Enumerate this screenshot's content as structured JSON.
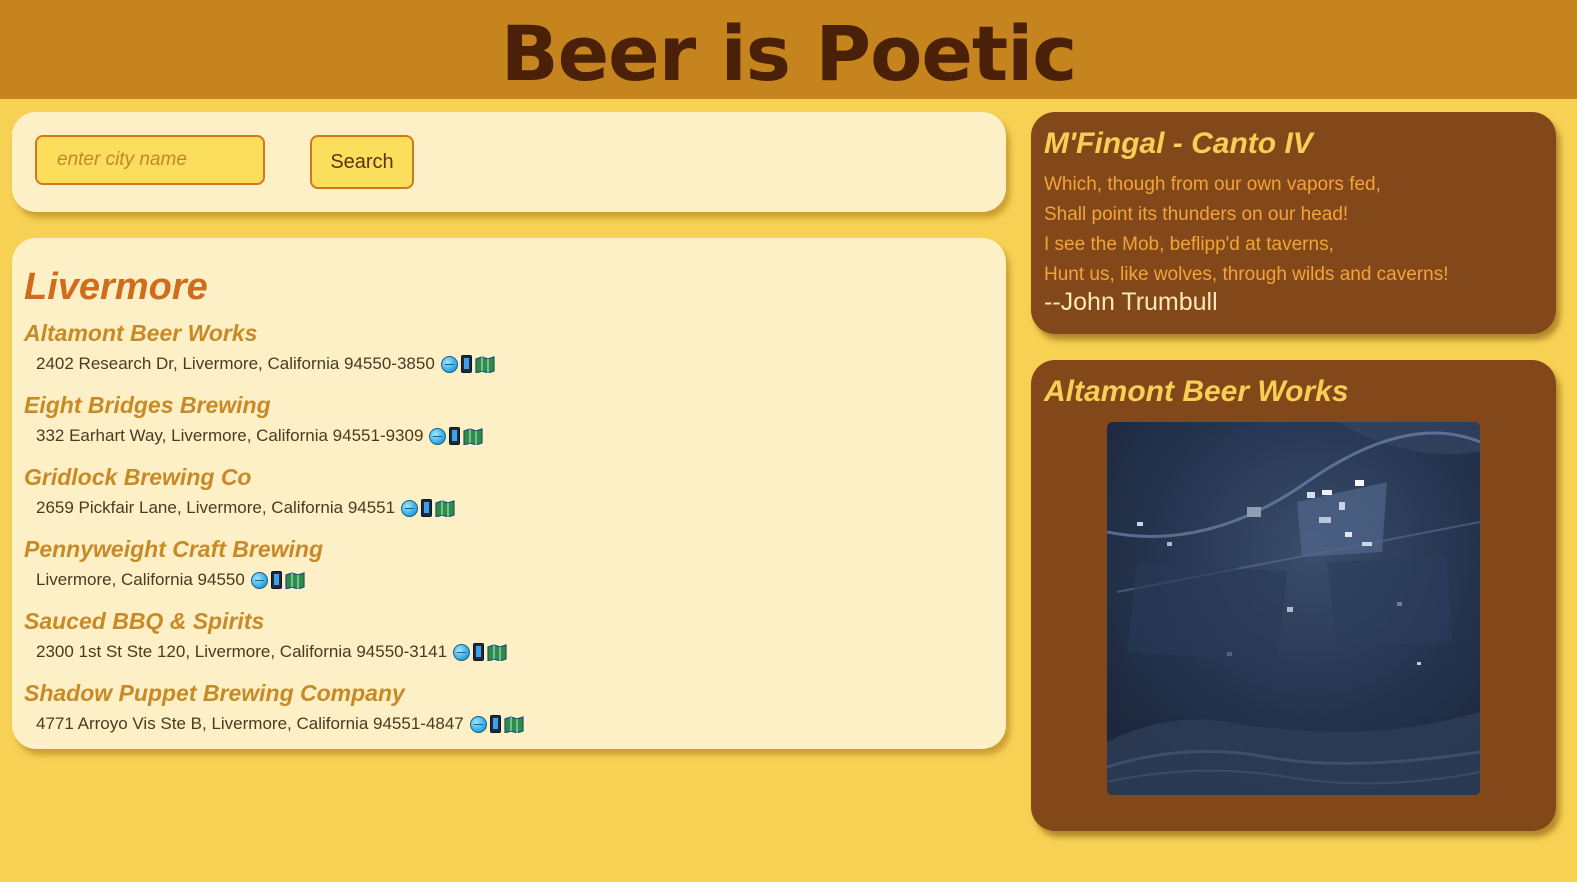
{
  "header": {
    "title": "Beer is Poetic"
  },
  "search": {
    "placeholder": "enter city name",
    "value": "",
    "button_label": "Search"
  },
  "results": {
    "city": "Livermore",
    "breweries": [
      {
        "name": "Altamont Beer Works",
        "address": "2402 Research Dr, Livermore, California 94550-3850"
      },
      {
        "name": "Eight Bridges Brewing",
        "address": "332 Earhart Way, Livermore, California 94551-9309"
      },
      {
        "name": "Gridlock Brewing Co",
        "address": "2659 Pickfair Lane, Livermore, California 94551"
      },
      {
        "name": "Pennyweight Craft Brewing",
        "address": "Livermore, California 94550"
      },
      {
        "name": "Sauced BBQ & Spirits",
        "address": "2300 1st St Ste 120, Livermore, California 94550-3141"
      },
      {
        "name": "Shadow Puppet Brewing Company",
        "address": "4771 Arroyo Vis Ste B, Livermore, California 94551-4847"
      }
    ],
    "link_icons": [
      "globe-icon",
      "phone-icon",
      "map-icon"
    ]
  },
  "poem": {
    "title": "M'Fingal - Canto IV",
    "lines": [
      "Which, though from our own vapors fed,",
      "Shall point its thunders on our head!",
      "I see the Mob, beflipp'd at taverns,",
      "Hunt us, like wolves, through wilds and caverns!"
    ],
    "author": "--John Trumbull"
  },
  "map": {
    "title": "Altamont Beer Works",
    "image": "satellite-map-image"
  },
  "colors": {
    "page_background": "#f7d154",
    "header_background": "#c5841e",
    "header_text": "#4a2108",
    "light_panel": "#fdf0c6",
    "dark_panel": "#83481a",
    "city_title": "#d06c1e",
    "brewery_name": "#c98a26",
    "poem_title": "#f8cf56",
    "poem_text": "#f2a33a",
    "author_text": "#fbe8b8"
  }
}
